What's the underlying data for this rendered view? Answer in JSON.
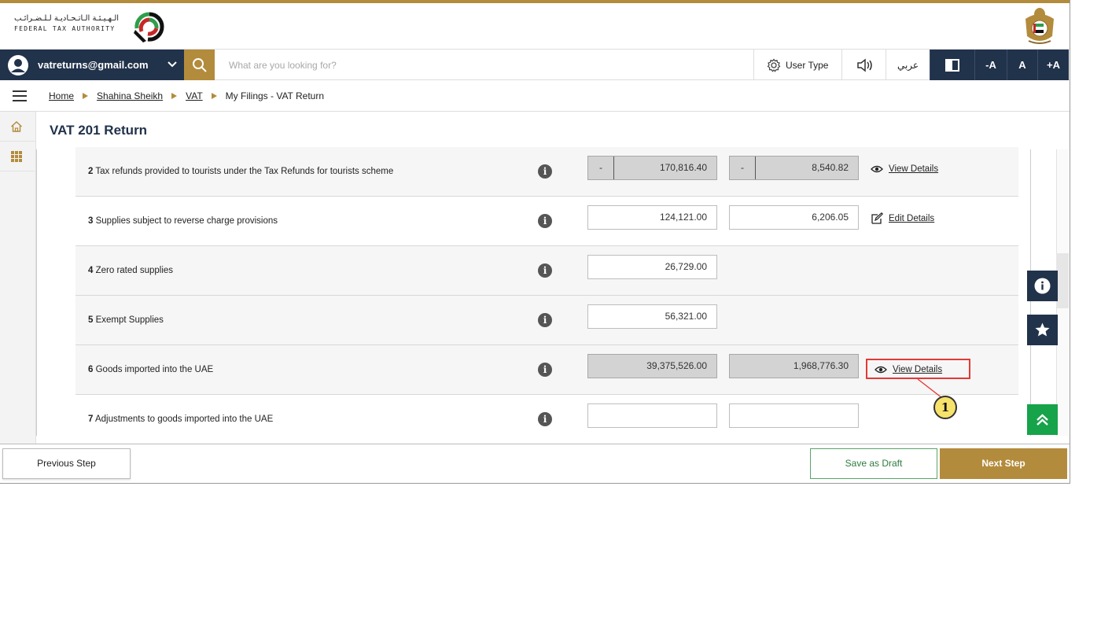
{
  "header": {
    "logo_arabic": "الـهـيـئـة الـاتـحـاديـة لـلـضـرائـب",
    "logo_english": "FEDERAL TAX AUTHORITY"
  },
  "topbar": {
    "user_email": "vatreturns@gmail.com",
    "search_placeholder": "What are you looking for?",
    "user_type": "User Type",
    "arabic_label": "عربي",
    "font_decrease": "-A",
    "font_normal": "A",
    "font_increase": "+A"
  },
  "breadcrumb": {
    "items": [
      "Home",
      "Shahina Sheikh",
      "VAT",
      "My Filings - VAT Return"
    ]
  },
  "page": {
    "title": "VAT 201 Return"
  },
  "rows": [
    {
      "num": "2",
      "label": "Tax refunds provided to tourists under the Tax Refunds for tourists scheme",
      "amount": "170,816.40",
      "vat": "8,540.82",
      "action": "View Details"
    },
    {
      "num": "3",
      "label": "Supplies subject to reverse charge provisions",
      "amount": "124,121.00",
      "vat": "6,206.05",
      "action": "Edit Details"
    },
    {
      "num": "4",
      "label": "Zero rated supplies",
      "amount": "26,729.00"
    },
    {
      "num": "5",
      "label": "Exempt Supplies",
      "amount": "56,321.00"
    },
    {
      "num": "6",
      "label": "Goods imported into the UAE",
      "amount": "39,375,526.00",
      "vat": "1,968,776.30",
      "action": "View Details"
    },
    {
      "num": "7",
      "label": "Adjustments to goods imported into the UAE",
      "amount": "",
      "vat": ""
    }
  ],
  "field_dash": "-",
  "callout": {
    "number": "1"
  },
  "footer": {
    "previous": "Previous Step",
    "draft": "Save as Draft",
    "next": "Next Step"
  },
  "colors": {
    "navy": "#21324b",
    "gold": "#b38b3c",
    "green": "#16a34a",
    "highlight": "#e53935"
  },
  "icons": [
    "user-circle-icon",
    "chevron-down-icon",
    "search-icon",
    "gear-icon",
    "speaker-icon",
    "contrast-icon",
    "hamburger-icon",
    "home-icon",
    "grid-icon",
    "info-icon",
    "eye-icon",
    "edit-icon",
    "star-icon",
    "double-chevron-up-icon"
  ]
}
